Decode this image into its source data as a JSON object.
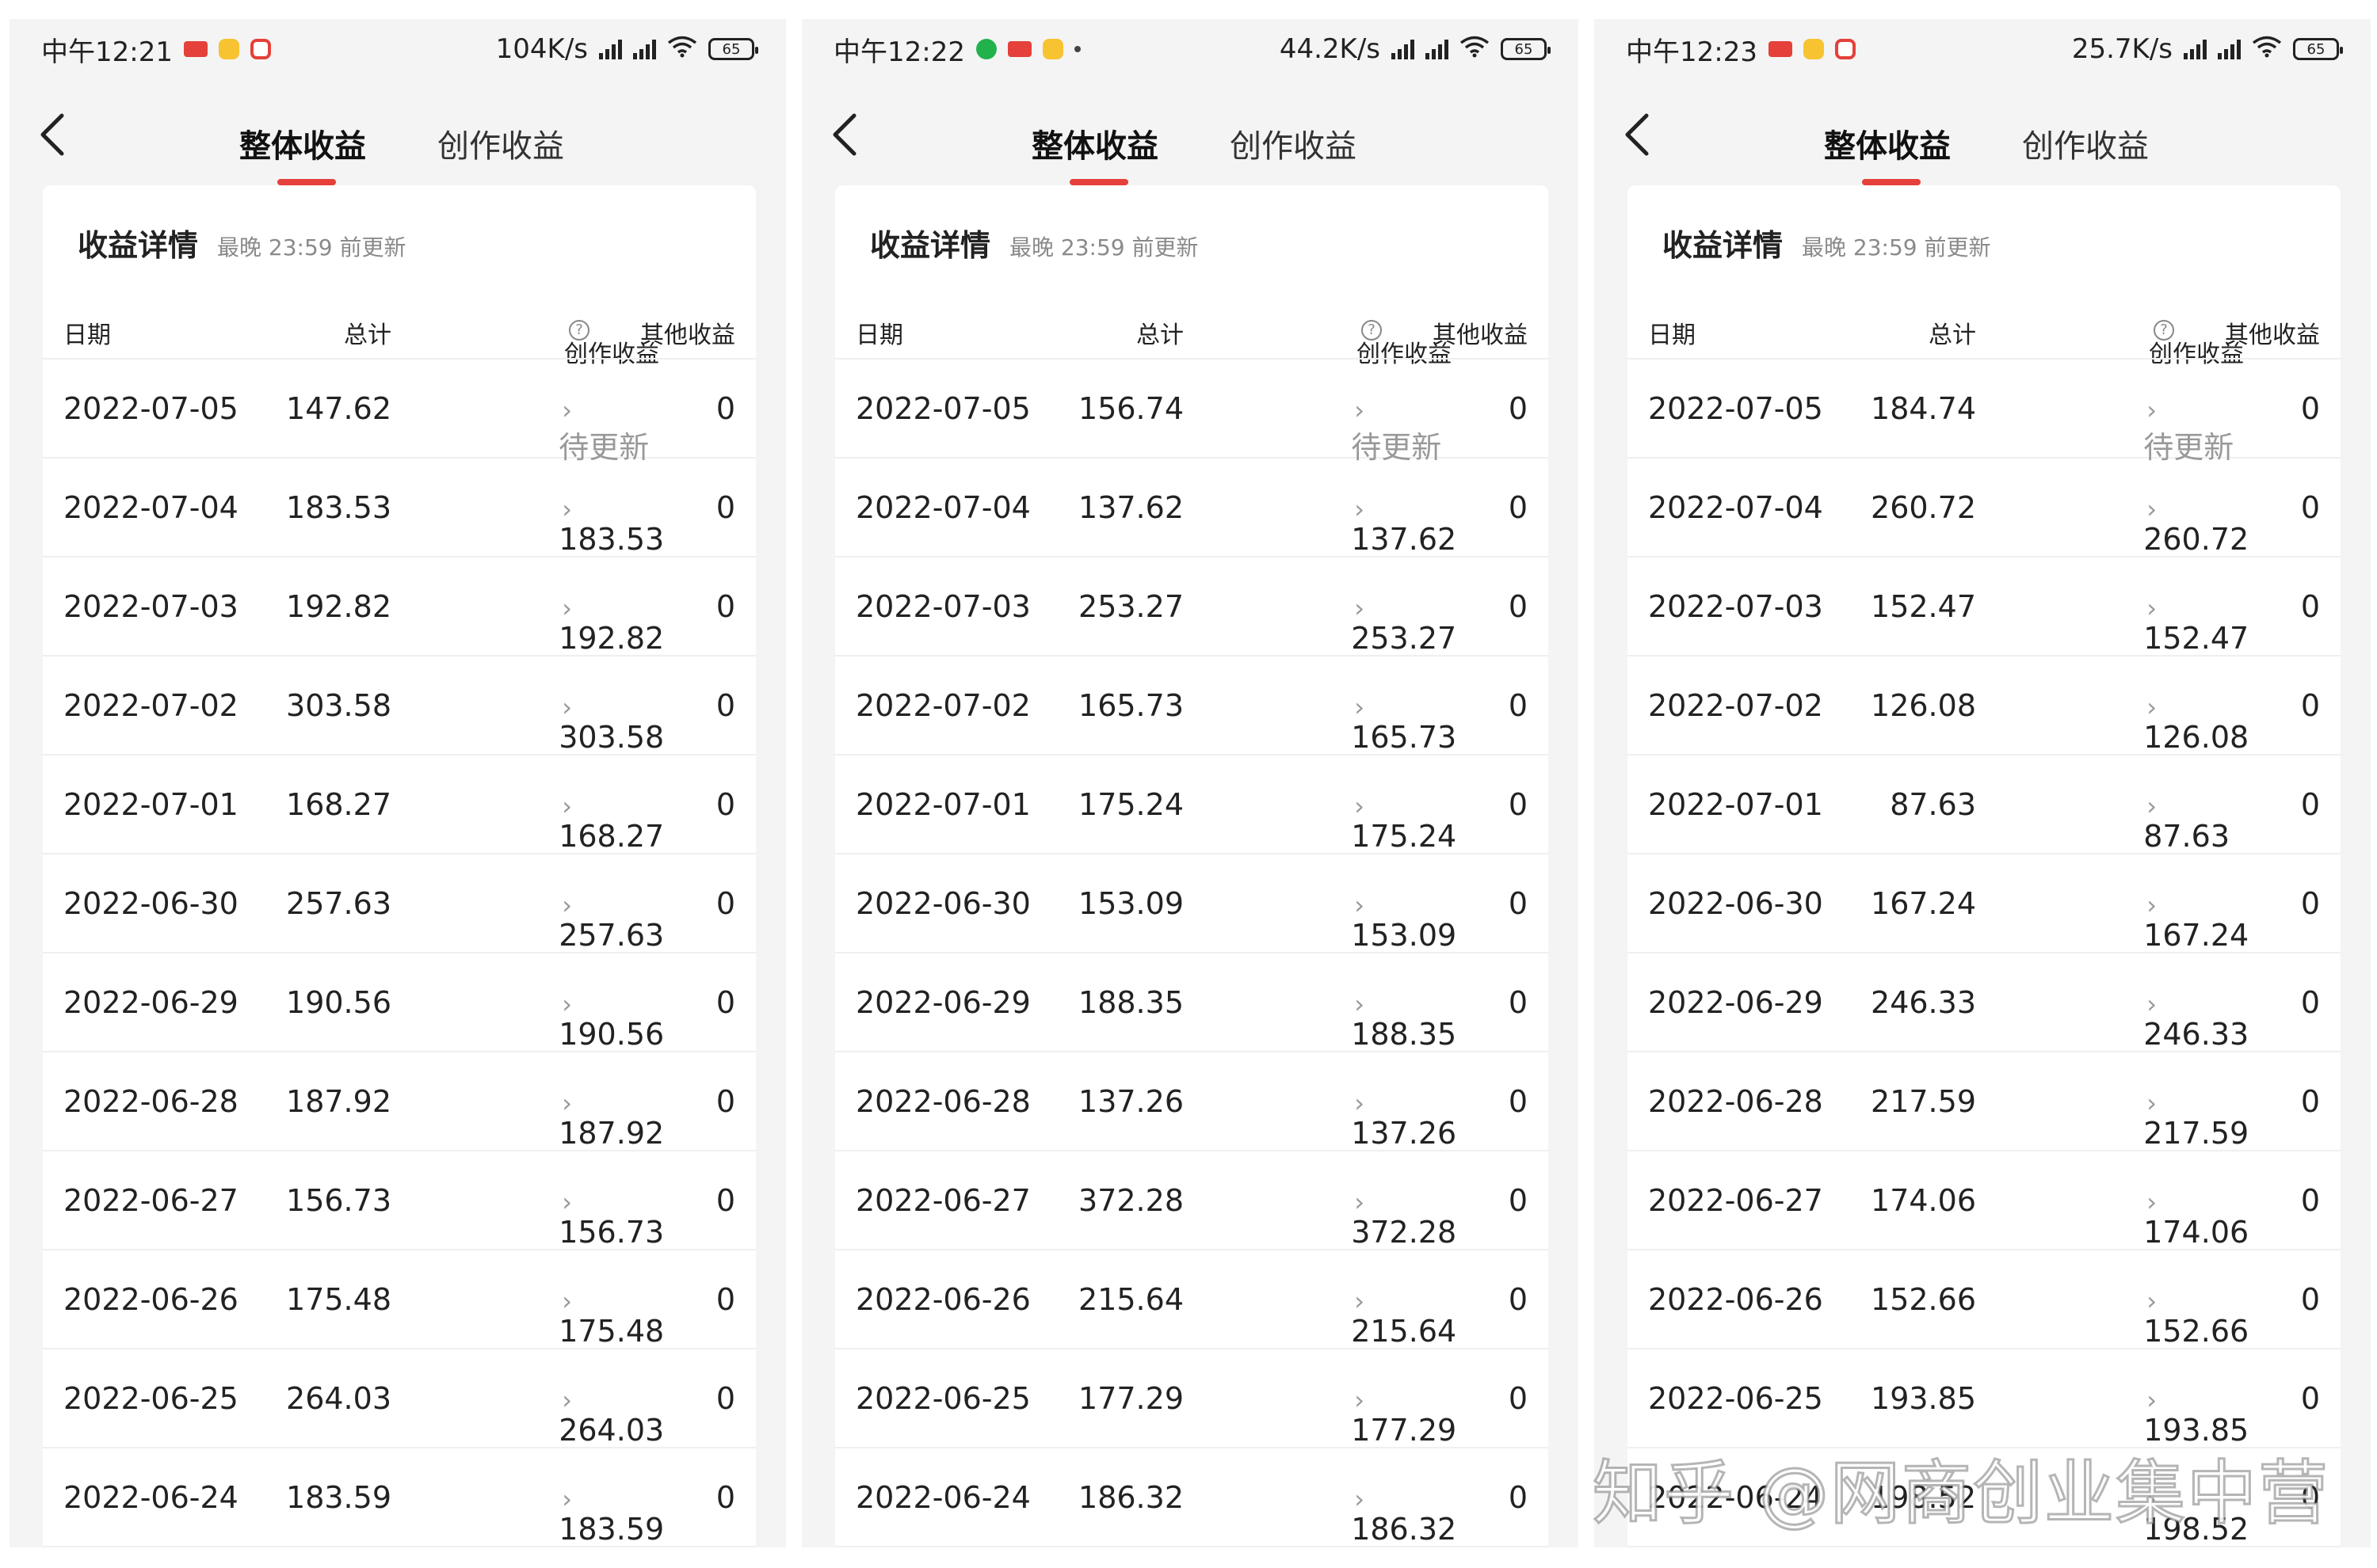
{
  "screens": [
    {
      "status_bar": {
        "time": "中午12:21",
        "speed": "104K/s",
        "battery": "65"
      },
      "tabs": [
        {
          "label": "整体收益",
          "active": true
        },
        {
          "label": "创作收益",
          "active": false
        }
      ],
      "card": {
        "title": "收益详情",
        "subtitle": "最晚 23:59 前更新"
      },
      "columns": [
        "日期",
        "总计",
        "创作收益",
        "其他收益"
      ],
      "rows": [
        {
          "date": "2022-07-05",
          "total": "147.62",
          "creation": "待更新",
          "other": "0"
        },
        {
          "date": "2022-07-04",
          "total": "183.53",
          "creation": "183.53",
          "other": "0"
        },
        {
          "date": "2022-07-03",
          "total": "192.82",
          "creation": "192.82",
          "other": "0"
        },
        {
          "date": "2022-07-02",
          "total": "303.58",
          "creation": "303.58",
          "other": "0"
        },
        {
          "date": "2022-07-01",
          "total": "168.27",
          "creation": "168.27",
          "other": "0"
        },
        {
          "date": "2022-06-30",
          "total": "257.63",
          "creation": "257.63",
          "other": "0"
        },
        {
          "date": "2022-06-29",
          "total": "190.56",
          "creation": "190.56",
          "other": "0"
        },
        {
          "date": "2022-06-28",
          "total": "187.92",
          "creation": "187.92",
          "other": "0"
        },
        {
          "date": "2022-06-27",
          "total": "156.73",
          "creation": "156.73",
          "other": "0"
        },
        {
          "date": "2022-06-26",
          "total": "175.48",
          "creation": "175.48",
          "other": "0"
        },
        {
          "date": "2022-06-25",
          "total": "264.03",
          "creation": "264.03",
          "other": "0"
        },
        {
          "date": "2022-06-24",
          "total": "183.59",
          "creation": "183.59",
          "other": "0"
        }
      ]
    },
    {
      "status_bar": {
        "time": "中午12:22",
        "speed": "44.2K/s",
        "battery": "65"
      },
      "tabs": [
        {
          "label": "整体收益",
          "active": true
        },
        {
          "label": "创作收益",
          "active": false
        }
      ],
      "card": {
        "title": "收益详情",
        "subtitle": "最晚 23:59 前更新"
      },
      "columns": [
        "日期",
        "总计",
        "创作收益",
        "其他收益"
      ],
      "rows": [
        {
          "date": "2022-07-05",
          "total": "156.74",
          "creation": "待更新",
          "other": "0"
        },
        {
          "date": "2022-07-04",
          "total": "137.62",
          "creation": "137.62",
          "other": "0"
        },
        {
          "date": "2022-07-03",
          "total": "253.27",
          "creation": "253.27",
          "other": "0"
        },
        {
          "date": "2022-07-02",
          "total": "165.73",
          "creation": "165.73",
          "other": "0"
        },
        {
          "date": "2022-07-01",
          "total": "175.24",
          "creation": "175.24",
          "other": "0"
        },
        {
          "date": "2022-06-30",
          "total": "153.09",
          "creation": "153.09",
          "other": "0"
        },
        {
          "date": "2022-06-29",
          "total": "188.35",
          "creation": "188.35",
          "other": "0"
        },
        {
          "date": "2022-06-28",
          "total": "137.26",
          "creation": "137.26",
          "other": "0"
        },
        {
          "date": "2022-06-27",
          "total": "372.28",
          "creation": "372.28",
          "other": "0"
        },
        {
          "date": "2022-06-26",
          "total": "215.64",
          "creation": "215.64",
          "other": "0"
        },
        {
          "date": "2022-06-25",
          "total": "177.29",
          "creation": "177.29",
          "other": "0"
        },
        {
          "date": "2022-06-24",
          "total": "186.32",
          "creation": "186.32",
          "other": "0"
        }
      ]
    },
    {
      "status_bar": {
        "time": "中午12:23",
        "speed": "25.7K/s",
        "battery": "65"
      },
      "tabs": [
        {
          "label": "整体收益",
          "active": true
        },
        {
          "label": "创作收益",
          "active": false
        }
      ],
      "card": {
        "title": "收益详情",
        "subtitle": "最晚 23:59 前更新"
      },
      "columns": [
        "日期",
        "总计",
        "创作收益",
        "其他收益"
      ],
      "rows": [
        {
          "date": "2022-07-05",
          "total": "184.74",
          "creation": "待更新",
          "other": "0"
        },
        {
          "date": "2022-07-04",
          "total": "260.72",
          "creation": "260.72",
          "other": "0"
        },
        {
          "date": "2022-07-03",
          "total": "152.47",
          "creation": "152.47",
          "other": "0"
        },
        {
          "date": "2022-07-02",
          "total": "126.08",
          "creation": "126.08",
          "other": "0"
        },
        {
          "date": "2022-07-01",
          "total": "87.63",
          "creation": "87.63",
          "other": "0"
        },
        {
          "date": "2022-06-30",
          "total": "167.24",
          "creation": "167.24",
          "other": "0"
        },
        {
          "date": "2022-06-29",
          "total": "246.33",
          "creation": "246.33",
          "other": "0"
        },
        {
          "date": "2022-06-28",
          "total": "217.59",
          "creation": "217.59",
          "other": "0"
        },
        {
          "date": "2022-06-27",
          "total": "174.06",
          "creation": "174.06",
          "other": "0"
        },
        {
          "date": "2022-06-26",
          "total": "152.66",
          "creation": "152.66",
          "other": "0"
        },
        {
          "date": "2022-06-25",
          "total": "193.85",
          "creation": "193.85",
          "other": "0"
        },
        {
          "date": "2022-06-24",
          "total": "198.52",
          "creation": "198.52",
          "other": "0"
        }
      ]
    }
  ],
  "watermark": "知乎 @网商创业集中营",
  "icons": {
    "back": "chevron-left-icon",
    "help": "question-circle-icon",
    "row_arrow": "chevron-right-icon",
    "wifi": "wifi-icon",
    "signal": "signal-icon",
    "battery": "battery-icon"
  },
  "colors": {
    "accent": "#e5403a",
    "background": "#f4f4f4",
    "card": "#ffffff",
    "muted": "#999999"
  }
}
